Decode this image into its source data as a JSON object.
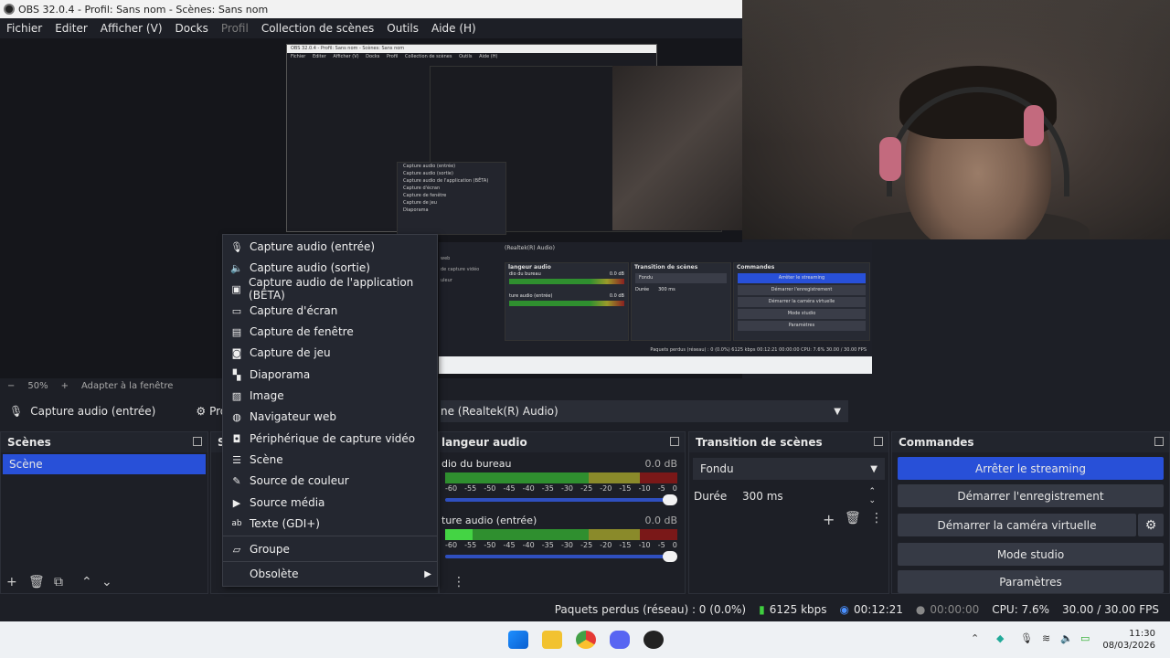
{
  "window": {
    "title": "OBS 32.0.4 - Profil: Sans nom - Scènes: Sans nom"
  },
  "menu": [
    "Fichier",
    "Editer",
    "Afficher (V)",
    "Docks",
    "Profil",
    "Collection de scènes",
    "Outils",
    "Aide (H)"
  ],
  "preview": {
    "zoom": "50%",
    "fit": "Adapter à la fenêtre"
  },
  "source_bar": {
    "selected_source": "Capture audio (entrée)",
    "properties": "Propri",
    "device": "ne (Realtek(R) Audio)"
  },
  "context_menu": {
    "items": [
      {
        "icon": "microphone-icon",
        "label": "Capture audio (entrée)"
      },
      {
        "icon": "speaker-icon",
        "label": "Capture audio (sortie)"
      },
      {
        "icon": "app-audio-icon",
        "label": "Capture audio de l'application (BÊTA)"
      },
      {
        "icon": "monitor-icon",
        "label": "Capture d'écran"
      },
      {
        "icon": "window-icon",
        "label": "Capture de fenêtre"
      },
      {
        "icon": "gamepad-icon",
        "label": "Capture de jeu"
      },
      {
        "icon": "slideshow-icon",
        "label": "Diaporama"
      },
      {
        "icon": "image-icon",
        "label": "Image"
      },
      {
        "icon": "globe-icon",
        "label": "Navigateur web"
      },
      {
        "icon": "camera-icon",
        "label": "Périphérique de capture vidéo"
      },
      {
        "icon": "list-icon",
        "label": "Scène"
      },
      {
        "icon": "brush-icon",
        "label": "Source de couleur"
      },
      {
        "icon": "play-icon",
        "label": "Source média"
      },
      {
        "icon": "text-icon",
        "label": "Texte (GDI+)"
      }
    ],
    "group": {
      "icon": "folder-icon",
      "label": "Groupe"
    },
    "deprecated": {
      "label": "Obsolète"
    }
  },
  "docks": {
    "scenes": {
      "title": "Scènes",
      "items": [
        "Scène"
      ]
    },
    "sources_partial": "S",
    "mixer": {
      "title": "langeur audio",
      "channels": [
        {
          "name": "dio du bureau",
          "db": "0.0 dB"
        },
        {
          "name": "ture audio (entrée)",
          "db": "0.0 dB"
        }
      ],
      "scale": [
        "-60",
        "-55",
        "-50",
        "-45",
        "-40",
        "-35",
        "-30",
        "-25",
        "-20",
        "-15",
        "-10",
        "-5",
        "0"
      ]
    },
    "transitions": {
      "title": "Transition de scènes",
      "type": "Fondu",
      "duration_label": "Durée",
      "duration": "300 ms"
    },
    "controls": {
      "title": "Commandes",
      "buttons": [
        "Arrêter le streaming",
        "Démarrer l'enregistrement",
        "Démarrer la caméra virtuelle",
        "Mode studio",
        "Paramètres"
      ]
    }
  },
  "status": {
    "dropped": "Paquets perdus (réseau) : 0 (0.0%)",
    "bitrate": "6125 kbps",
    "stream_time": "00:12:21",
    "rec_time": "00:00:00",
    "cpu": "CPU: 7.6%",
    "fps": "30.00 / 30.00 FPS"
  },
  "nested": {
    "title": "OBS 32.0.4 - Profil: Sans nom - Scènes: Sans nom",
    "menu": [
      "Fichier",
      "Editer",
      "Afficher (V)",
      "Docks",
      "Profil",
      "Collection de scènes",
      "Outils",
      "Aide (H)"
    ],
    "menu_items": [
      "Capture audio (entrée)",
      "Capture audio (sortie)",
      "Capture audio de l'application (BÊTA)",
      "Capture d'écran",
      "Capture de fenêtre",
      "Capture de jeu",
      "Diaporama"
    ],
    "mixer_title": "langeur audio",
    "transition_title": "Transition de scènes",
    "controls_title": "Commandes",
    "transition_type": "Fondu",
    "duration_label": "Durée",
    "duration": "300 ms",
    "device": "(Realtek(R) Audio)",
    "channel1": "dio du bureau",
    "channel2": "ture audio (entrée)",
    "db": "0.0 dB",
    "controls": [
      "Arrêter le streaming",
      "Démarrer l'enregistrement",
      "Démarrer la caméra virtuelle",
      "Mode studio",
      "Paramètres"
    ],
    "status": "Paquets perdus (réseau) : 0 (0.0%)   6125 kbps   00:12:21   00:00:00   CPU: 7.6%   30.00 / 30.00 FPS",
    "partial_labels": [
      "web",
      "de capture vidéo",
      "uleur"
    ]
  },
  "taskbar": {
    "time": "11:30",
    "date": "08/03/2026"
  },
  "colors": {
    "accent": "#2850d8",
    "panel": "#1d1f26",
    "menu_bg": "#242730"
  }
}
